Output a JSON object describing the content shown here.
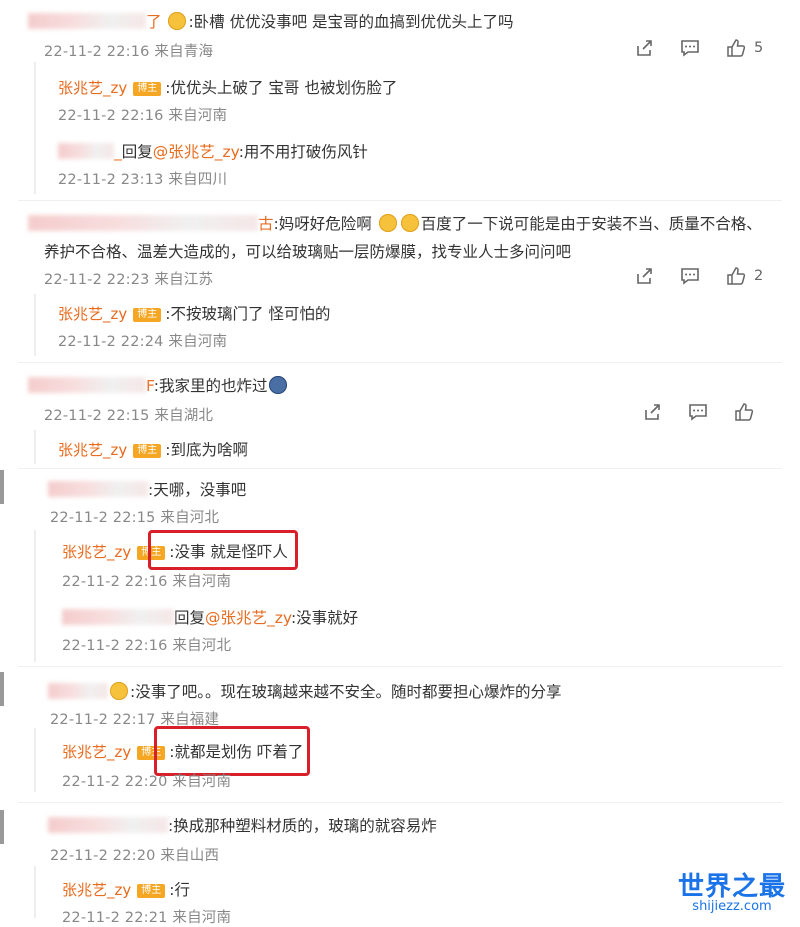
{
  "comments": [
    {
      "text": ":卧槽 优优没事吧 是宝哥的血搞到优优头上了吗",
      "meta": "22-11-2 22:16 来自青海",
      "likes": "5"
    },
    {
      "text1": ":妈呀好危险啊",
      "text2": "百度了一下说可能是由于安装不当、质量不合格、",
      "text3": "养护不合格、温差大造成的，可以给玻璃贴一层防爆膜，找专业人士多问问吧",
      "meta": "22-11-2 22:23 来自江苏",
      "likes": "2"
    },
    {
      "text": ":我家里的也炸过",
      "meta": "22-11-2 22:15 来自湖北"
    },
    {
      "text": ":天哪，没事吧",
      "meta": "22-11-2 22:15 来自河北"
    },
    {
      "text": ":没事了吧。。现在玻璃越来越不安全。随时都要担心爆炸的分享",
      "meta": "22-11-2 22:17 来自福建"
    },
    {
      "text": ":换成那种塑料材质的，玻璃的就容易炸",
      "meta": "22-11-2 22:20 来自山西"
    }
  ],
  "replies": {
    "author": "张兆艺_zy",
    "badge": "博主",
    "r1": {
      "text": ":优优头上破了 宝哥 也被划伤脸了",
      "meta": "22-11-2 22:16 来自河南"
    },
    "r1b": {
      "prefix": "回复",
      "mention": "@张兆艺_zy",
      "text": ":用不用打破伤风针",
      "meta": "22-11-2 23:13 来自四川"
    },
    "r2": {
      "text": ":不按玻璃门了 怪可怕的",
      "meta": "22-11-2 22:24 来自河南"
    },
    "r3": {
      "text": ":到底为啥啊"
    },
    "r4": {
      "text": ":没事 就是怪吓人",
      "meta": "22-11-2 22:16 来自河南"
    },
    "r4b": {
      "prefix": "回复",
      "mention": "@张兆艺_zy",
      "text": ":没事就好",
      "meta": "22-11-2 22:16 来自河北"
    },
    "r5": {
      "text": ":就都是划伤 吓着了",
      "meta": "22-11-2 22:20 来自河南"
    },
    "r6": {
      "text": ":行",
      "meta": "22-11-2 22:21 来自河南"
    }
  },
  "colors": {
    "username": "#e86b1f",
    "badge": "#f5a623",
    "highlight": "#d9202a",
    "watermark": "#1a73e8"
  },
  "watermark": {
    "main": "世界之最",
    "sub": "shijiezz.com"
  },
  "icons": [
    "share-icon",
    "comment-icon",
    "like-icon"
  ]
}
